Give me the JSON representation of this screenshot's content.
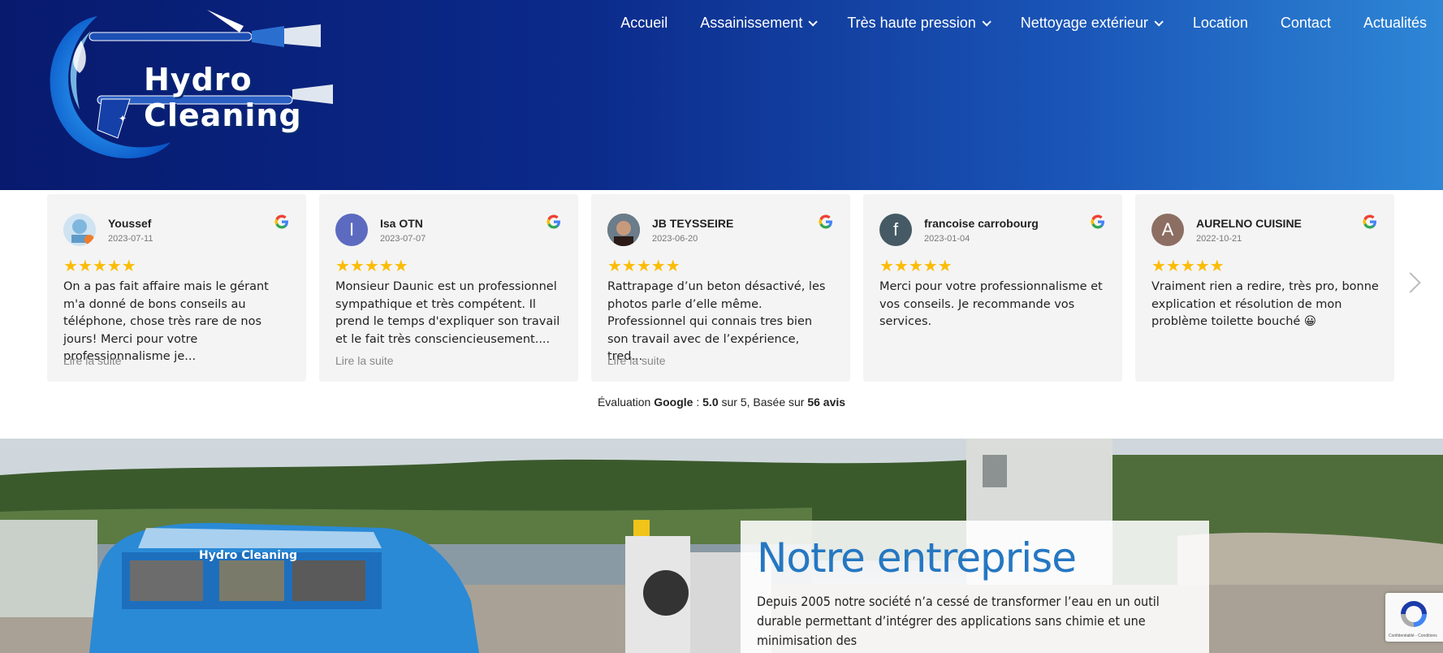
{
  "brand": {
    "logo_text": "Hydro Cleaning"
  },
  "nav": {
    "items": [
      {
        "label": "Accueil",
        "dropdown": false
      },
      {
        "label": "Assainissement",
        "dropdown": true
      },
      {
        "label": "Très haute pression",
        "dropdown": true
      },
      {
        "label": "Nettoyage extérieur",
        "dropdown": true
      },
      {
        "label": "Location",
        "dropdown": false
      },
      {
        "label": "Contact",
        "dropdown": false
      },
      {
        "label": "Actualités",
        "dropdown": false
      }
    ]
  },
  "reviews": {
    "items": [
      {
        "name": "Youssef",
        "date": "2023-07-11",
        "rating": 5,
        "avatar_letter": "",
        "avatar_color": "#cfe3f2",
        "text": "On a pas fait affaire mais le gérant m'a donné de bons conseils au téléphone, chose très rare de nos jours! Merci pour votre professionnalisme je...",
        "read_more": "Lire la suite"
      },
      {
        "name": "Isa OTN",
        "date": "2023-07-07",
        "rating": 5,
        "avatar_letter": "I",
        "avatar_color": "#5c6bc0",
        "text": "Monsieur Daunic est un professionnel sympathique et très compétent. Il prend le temps d'expliquer son travail et le fait très consciencieusement....",
        "read_more": "Lire la suite"
      },
      {
        "name": "JB TEYSSEIRE",
        "date": "2023-06-20",
        "rating": 5,
        "avatar_letter": "",
        "avatar_color": "#3b2a24",
        "text": "Rattrapage d’un beton désactivé, les photos parle d’elle même. Professionnel qui connais tres bien son travail avec de l’expérience, tred...",
        "read_more": "Lire la suite"
      },
      {
        "name": "francoise carrobourg",
        "date": "2023-01-04",
        "rating": 5,
        "avatar_letter": "f",
        "avatar_color": "#455a64",
        "text": "Merci pour votre professionnalisme et vos conseils. Je recommande vos services.",
        "read_more": ""
      },
      {
        "name": "AURELNO CUISINE",
        "date": "2022-10-21",
        "rating": 5,
        "avatar_letter": "A",
        "avatar_color": "#8d6e63",
        "text": "Vraiment rien a redire, très pro, bonne explication et résolution de mon problème toilette bouché 😀",
        "read_more": ""
      }
    ],
    "summary": {
      "prefix": "Évaluation ",
      "source": "Google",
      "sep": " : ",
      "score": "5.0",
      "mid": " sur 5, Basée sur ",
      "count": "56 avis"
    }
  },
  "about": {
    "title": "Notre entreprise",
    "text": "Depuis 2005 notre société n’a cessé de transformer l’eau en un outil durable permettant d’intégrer des applications sans chimie et une minimisation des"
  },
  "recaptcha": {
    "label": "Confidentialité - Conditions"
  },
  "colors": {
    "star": "#fbbc04",
    "accent": "#2577c2",
    "header_start": "#071a6e",
    "header_end": "#2e86d6"
  }
}
